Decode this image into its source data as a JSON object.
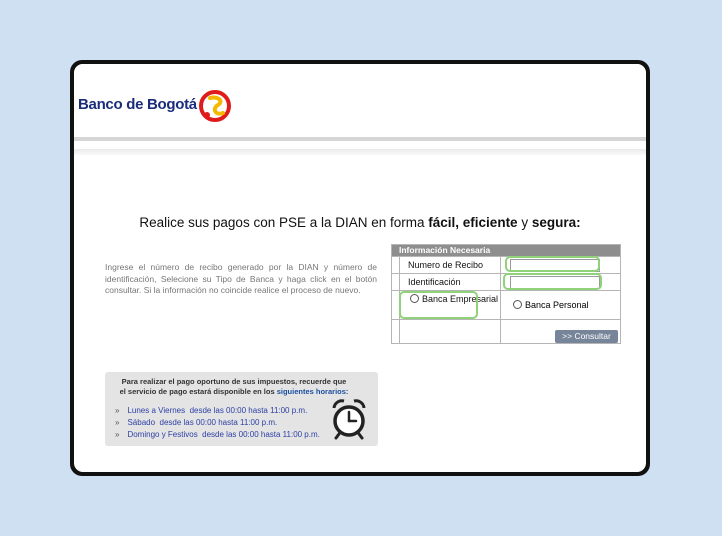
{
  "brand": {
    "name": "Banco de Bogotá",
    "colors": {
      "navy": "#1b2c7c",
      "red": "#e01b1b",
      "yellow": "#f5b800"
    }
  },
  "headline": {
    "prefix": "Realice sus pagos con PSE a la DIAN en forma ",
    "bold1": "fácil, eficiente",
    "mid": " y ",
    "bold2": "segura:"
  },
  "instructions": "Ingrese el número de recibo generado por la DIAN y número de identificación, Selecione su Tipo de Banca y haga click en el botón consultar. Si la información no coincide realice el proceso de nuevo.",
  "form": {
    "header": "Información Necesaria",
    "receipt_label": "Numero de Recibo",
    "receipt_value": "",
    "id_label": "Identificación",
    "id_value": "",
    "banca_empresarial": "Banca Empresarial",
    "banca_personal": "Banca Personal",
    "submit": ">> Consultar",
    "highlight_color": "#8fd27a"
  },
  "schedule": {
    "intro": "Para realizar el pago oportuno de sus impuestos, recuerde que el servicio de pago estará disponible en los ",
    "intro_link": "siguientes horarios:",
    "items": [
      {
        "bullet": "»",
        "day": "Lunes a Viernes",
        "hours": "desde las 00:00 hasta 11:00 p.m."
      },
      {
        "bullet": "»",
        "day": "Sábado",
        "hours": "desde las 00:00 hasta 11:00 p.m."
      },
      {
        "bullet": "»",
        "day": "Domingo y Festivos",
        "hours": "desde las 00:00 hasta 11:00 p.m."
      }
    ],
    "icon": "alarm-clock-icon"
  }
}
